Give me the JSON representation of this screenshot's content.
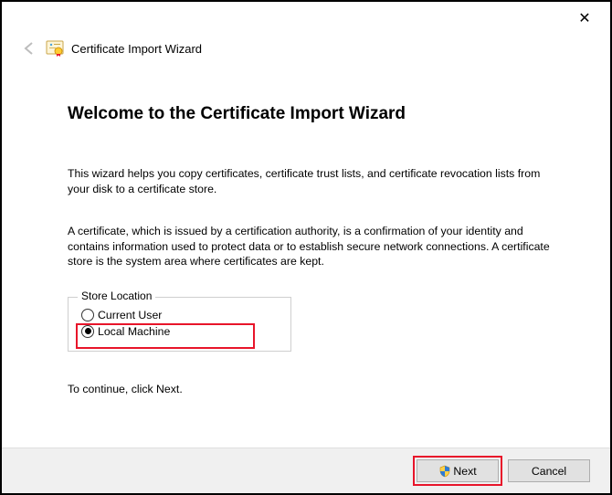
{
  "window": {
    "title": "Certificate Import Wizard"
  },
  "heading": "Welcome to the Certificate Import Wizard",
  "intro_paragraph": "This wizard helps you copy certificates, certificate trust lists, and certificate revocation lists from your disk to a certificate store.",
  "explain_paragraph": "A certificate, which is issued by a certification authority, is a confirmation of your identity and contains information used to protect data or to establish secure network connections. A certificate store is the system area where certificates are kept.",
  "store_location": {
    "legend": "Store Location",
    "options": [
      {
        "label": "Current User",
        "checked": false
      },
      {
        "label": "Local Machine",
        "checked": true
      }
    ]
  },
  "continue_hint": "To continue, click Next.",
  "buttons": {
    "next": "Next",
    "cancel": "Cancel"
  }
}
